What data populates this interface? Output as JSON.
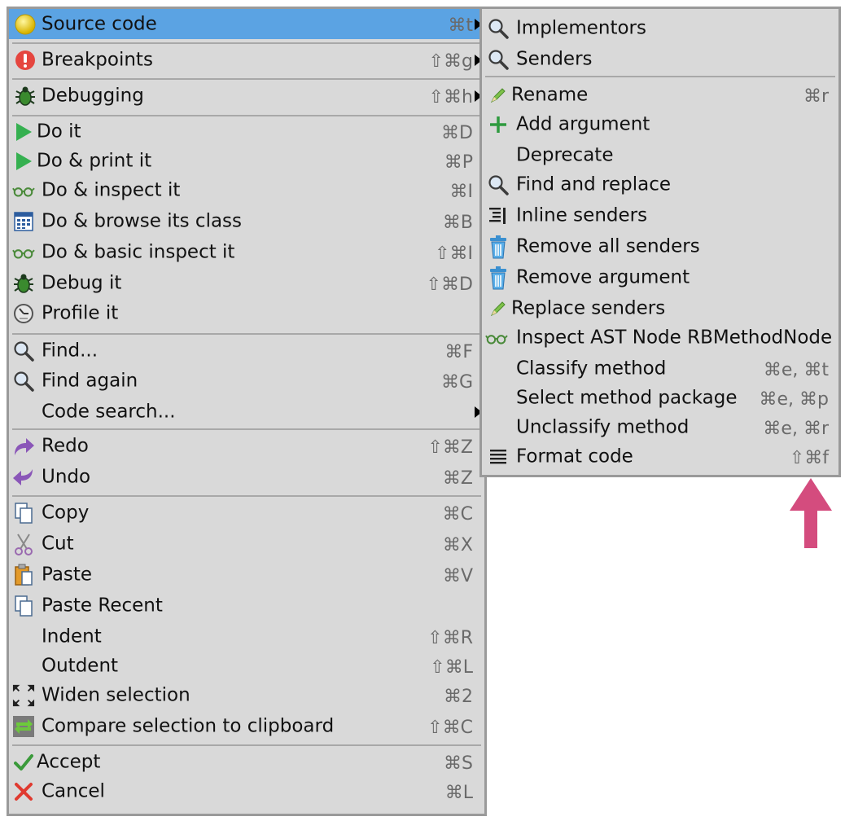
{
  "main_menu": {
    "items": [
      {
        "label": "Source code",
        "shortcut": "⌘t",
        "icon": "yellow-ball-icon",
        "submenu": true,
        "selected": true
      },
      {
        "label": "Breakpoints",
        "shortcut": "⇧⌘g",
        "icon": "exclamation-icon",
        "submenu": true
      },
      {
        "label": "Debugging",
        "shortcut": "⇧⌘h",
        "icon": "bug-icon",
        "submenu": true
      },
      {
        "label": "Do it",
        "shortcut": "⌘D",
        "icon": "play-icon"
      },
      {
        "label": "Do & print it",
        "shortcut": "⌘P",
        "icon": "play-icon"
      },
      {
        "label": "Do & inspect it",
        "shortcut": "⌘I",
        "icon": "glasses-icon"
      },
      {
        "label": "Do & browse its class",
        "shortcut": "⌘B",
        "icon": "browse-icon"
      },
      {
        "label": "Do & basic inspect it",
        "shortcut": "⇧⌘I",
        "icon": "glasses-icon"
      },
      {
        "label": "Debug it",
        "shortcut": "⇧⌘D",
        "icon": "bug-icon"
      },
      {
        "label": "Profile it",
        "shortcut": "",
        "icon": "profile-icon"
      },
      {
        "label": "Find...",
        "shortcut": "⌘F",
        "icon": "magnifier-icon"
      },
      {
        "label": "Find again",
        "shortcut": "⌘G",
        "icon": "magnifier-icon"
      },
      {
        "label": "Code search...",
        "shortcut": "",
        "icon": "",
        "submenu": true
      },
      {
        "label": "Redo",
        "shortcut": "⇧⌘Z",
        "icon": "redo-icon"
      },
      {
        "label": "Undo",
        "shortcut": "⌘Z",
        "icon": "undo-icon"
      },
      {
        "label": "Copy",
        "shortcut": "⌘C",
        "icon": "copy-icon"
      },
      {
        "label": "Cut",
        "shortcut": "⌘X",
        "icon": "scissors-icon"
      },
      {
        "label": "Paste",
        "shortcut": "⌘V",
        "icon": "paste-icon"
      },
      {
        "label": "Paste Recent",
        "shortcut": "",
        "icon": "copy-icon"
      },
      {
        "label": "Indent",
        "shortcut": "⇧⌘R",
        "icon": ""
      },
      {
        "label": "Outdent",
        "shortcut": "⇧⌘L",
        "icon": ""
      },
      {
        "label": "Widen selection",
        "shortcut": "⌘2",
        "icon": "expand-icon"
      },
      {
        "label": "Compare selection to clipboard",
        "shortcut": "⇧⌘C",
        "icon": "compare-icon"
      },
      {
        "label": "Accept",
        "shortcut": "⌘S",
        "icon": "check-icon"
      },
      {
        "label": "Cancel",
        "shortcut": "⌘L",
        "icon": "cross-icon"
      }
    ]
  },
  "sub_menu": {
    "items": [
      {
        "label": "Implementors",
        "shortcut": "",
        "icon": "magnifier-icon"
      },
      {
        "label": "Senders",
        "shortcut": "",
        "icon": "magnifier-icon"
      },
      {
        "label": "Rename",
        "shortcut": "⌘r",
        "icon": "pencil-icon"
      },
      {
        "label": "Add argument",
        "shortcut": "",
        "icon": "plus-icon"
      },
      {
        "label": "Deprecate",
        "shortcut": "",
        "icon": ""
      },
      {
        "label": "Find and replace",
        "shortcut": "",
        "icon": "magnifier-icon"
      },
      {
        "label": "Inline senders",
        "shortcut": "",
        "icon": "inline-icon"
      },
      {
        "label": "Remove all senders",
        "shortcut": "",
        "icon": "trash-icon"
      },
      {
        "label": "Remove argument",
        "shortcut": "",
        "icon": "trash-icon"
      },
      {
        "label": "Replace senders",
        "shortcut": "",
        "icon": "pencil-icon"
      },
      {
        "label": "Inspect AST Node RBMethodNode",
        "shortcut": "",
        "icon": "glasses-icon"
      },
      {
        "label": "Classify method",
        "shortcut": "⌘e, ⌘t",
        "icon": ""
      },
      {
        "label": "Select method package",
        "shortcut": "⌘e, ⌘p",
        "icon": ""
      },
      {
        "label": "Unclassify method",
        "shortcut": "⌘e, ⌘r",
        "icon": ""
      },
      {
        "label": "Format code",
        "shortcut": "⇧⌘f",
        "icon": "lines-icon"
      }
    ]
  },
  "annotation": {
    "color": "#d44c7e",
    "icon": "up-arrow-icon"
  },
  "colors": {
    "menu_bg": "#d9d9d9",
    "selection": "#5ba3e3",
    "border": "#9a9a9a",
    "shortcut": "#6a6a6a"
  }
}
